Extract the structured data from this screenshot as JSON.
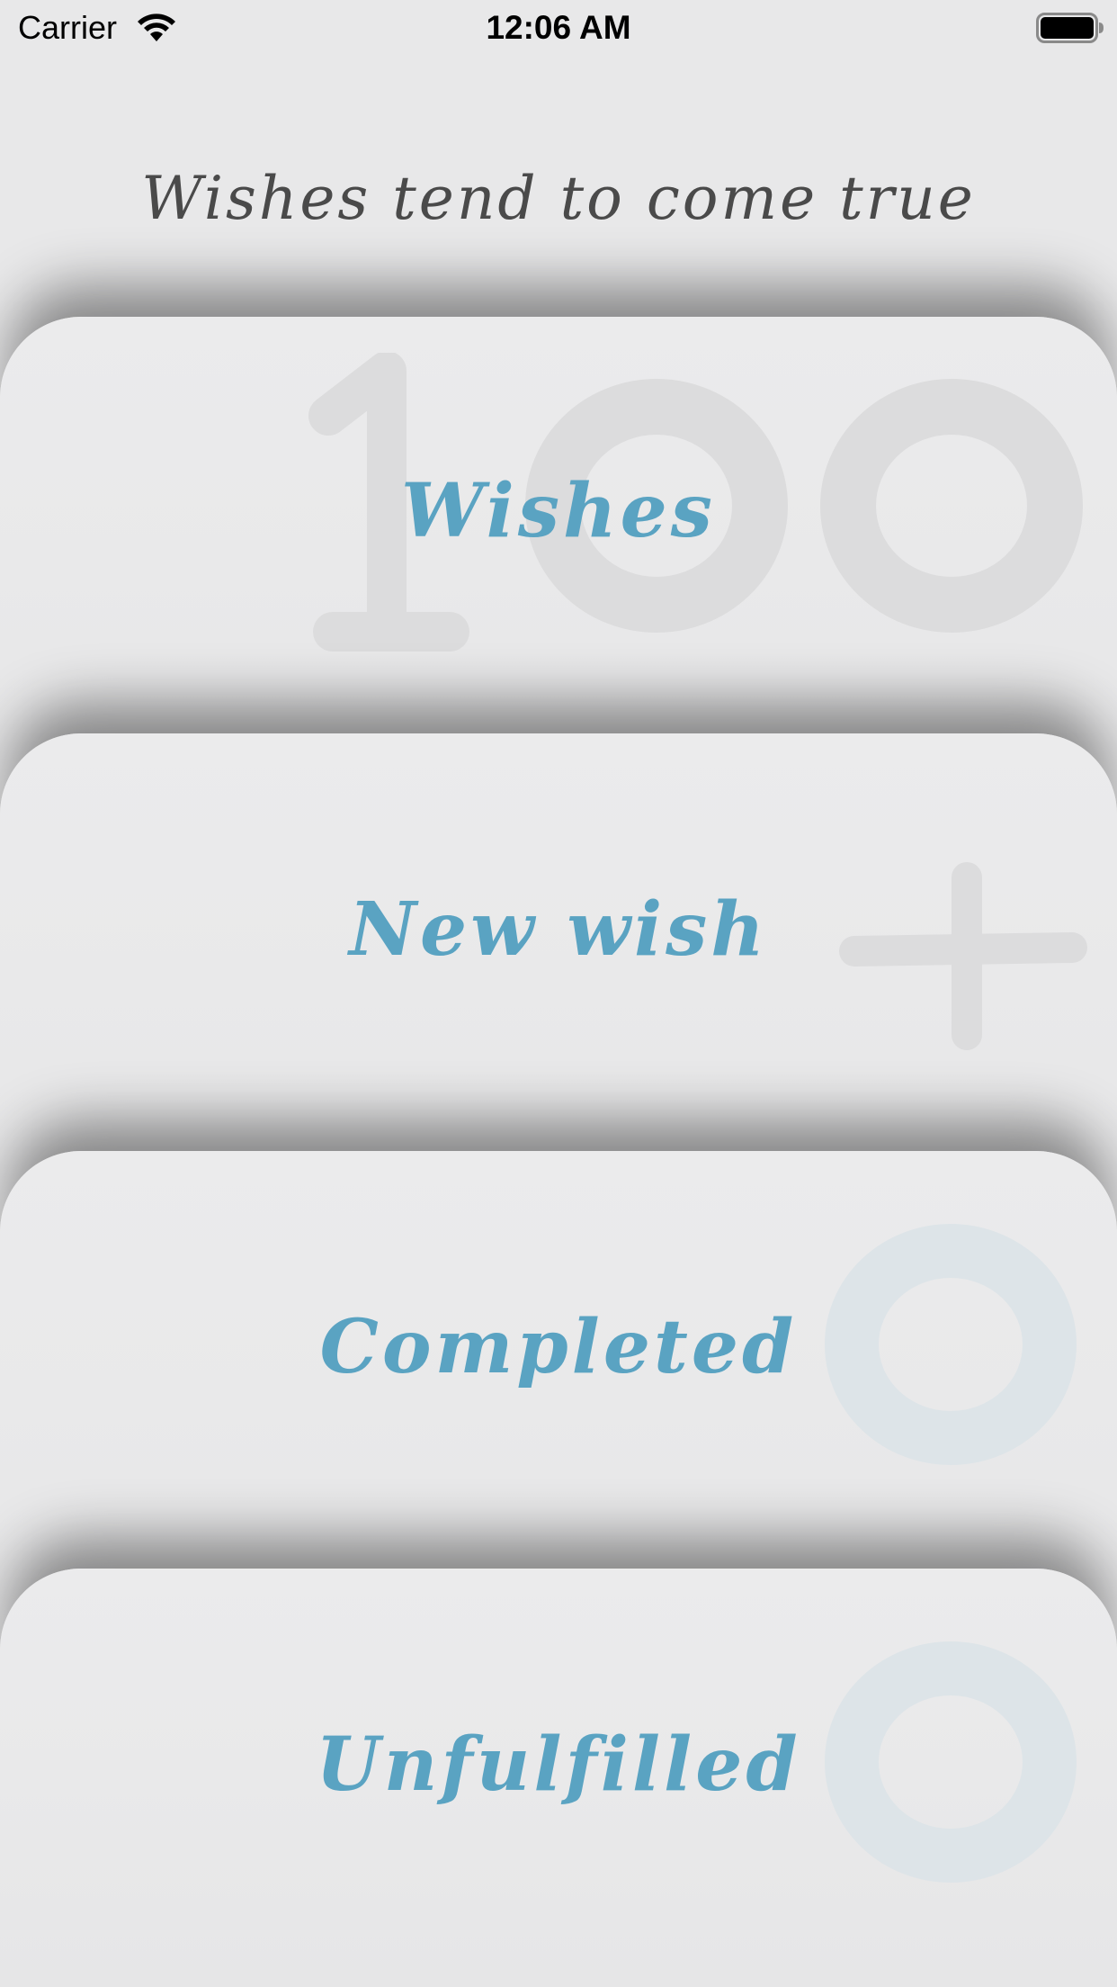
{
  "status_bar": {
    "carrier": "Carrier",
    "time": "12:06 AM",
    "wifi_icon": "wifi-icon",
    "battery_icon": "battery-icon"
  },
  "header": {
    "title": "Wishes tend to come true"
  },
  "menu": {
    "items": [
      {
        "label": "Wishes",
        "badge": "100",
        "decoration": "number-100"
      },
      {
        "label": "New wish",
        "decoration": "plus-icon"
      },
      {
        "label": "Completed",
        "badge": "0",
        "decoration": "number-0"
      },
      {
        "label": "Unfulfilled",
        "badge": "0",
        "decoration": "number-0"
      }
    ]
  },
  "colors": {
    "background": "#e8e8e9",
    "title_text": "#4a4a4a",
    "accent_text": "#5aa3c2",
    "watermark_gray": "#dcdcdd",
    "watermark_blue": "#dde4e8"
  }
}
